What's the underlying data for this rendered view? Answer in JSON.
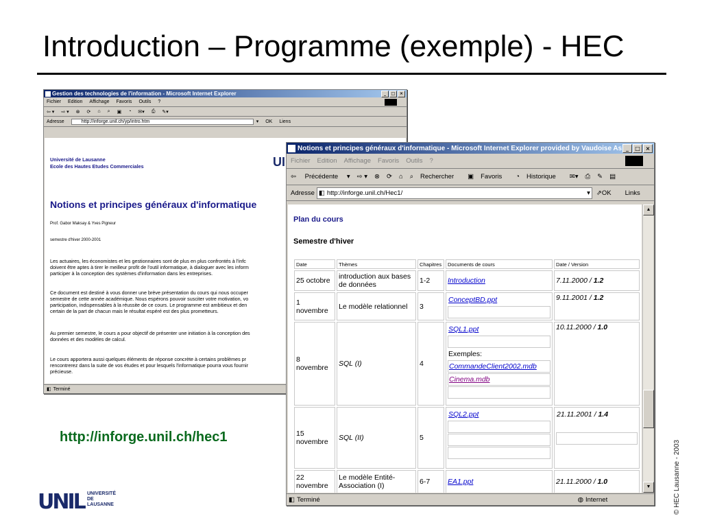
{
  "slide": {
    "title": "Introduction – Programme (exemple) - HEC",
    "url": "http://inforge.unil.ch/hec1",
    "copyright": "© HEC Lausanne - 2003",
    "logo_mark": "UNIL",
    "logo_words": [
      "UNIVERSITÉ",
      "DE",
      "LAUSANNE"
    ]
  },
  "back_window": {
    "title": "Gestion des technologies de l'information - Microsoft Internet Explorer",
    "menu": [
      "Fichier",
      "Edition",
      "Affichage",
      "Favoris",
      "Outils",
      "?"
    ],
    "address_label": "Adresse",
    "address": "http://inforge.unil.ch/yp/intro.htm",
    "go": "OK",
    "links": "Liens",
    "university": "Université de Lausanne",
    "school": "Ecole des Hautes Etudes Commerciales",
    "heading": "Notions et principes généraux d'informatique",
    "authors": "Prof. Gabor Maksay & Yves Pigneur",
    "semester": "semestre d'hiver 2000-2001",
    "paragraphs": [
      [
        "Les actuaires, les économistes et les gestionnaires sont de plus en plus confrontés à l'infc",
        "doivent être aptes à tirer le meilleur profit de l'outil informatique, à dialoguer avec les inform",
        "participer à la conception des systèmes d'information dans les entreprises."
      ],
      [
        "Ce document est destiné à vous donner une brève présentation du cours qui nous occuper",
        "semestre de cette année académique. Nous espérons pouvoir susciter votre motivation, vo",
        "participation, indispensables à la réussite de ce cours. Le programme est ambitieux et den",
        "certain de la part de chacun mais le résultat espéré est des plus prometteurs."
      ],
      [
        "Au premier semestre, le cours a pour objectif de présenter une initiation à la conception des",
        "données et des modèles de calcul."
      ],
      [
        "Le cours apportera aussi quelques éléments de réponse concrète à certains problèmes pr",
        "rencontrerez dans la suite de vos études et pour lesquels l'informatique pourra vous fournir",
        "précieuse."
      ]
    ],
    "status": "Terminé"
  },
  "front_window": {
    "title": "Notions et principes généraux d'informatique - Microsoft Internet Explorer provided by Vaudoise As...",
    "menu": [
      "Fichier",
      "Edition",
      "Affichage",
      "Favoris",
      "Outils",
      "?"
    ],
    "toolbar": {
      "back": "Précédente",
      "search": "Rechercher",
      "favorites": "Favoris",
      "history": "Historique"
    },
    "address_label": "Adresse",
    "address": "http://inforge.unil.ch/Hec1/",
    "go": "OK",
    "links": "Links",
    "plan_title": "Plan du cours",
    "semester": "Semestre d'hiver",
    "columns": [
      "Date",
      "Thèmes",
      "Chapitres",
      "Documents de cours",
      "Date / Version"
    ],
    "rows": [
      {
        "date": "25 octobre",
        "theme": "introduction aux bases de données",
        "chap": "1-2",
        "docs": [
          "Introduction"
        ],
        "version": "7.11.2000 / ",
        "ver": "1.2"
      },
      {
        "date": "1 novembre",
        "theme": "Le modèle relationnel",
        "chap": "3",
        "docs": [
          "ConceptBD.ppt"
        ],
        "version": "9.11.2001 / ",
        "ver": "1.2"
      },
      {
        "date": "8 novembre",
        "theme": "SQL (I)",
        "chap": "4",
        "docs": [
          "SQL1.ppt",
          "Exemples:",
          "CommandeClient2002.mdb",
          "Cinema.mdb"
        ],
        "version": "10.11.2000 / ",
        "ver": "1.0"
      },
      {
        "date": "15 novembre",
        "theme": "SQL (II)",
        "chap": "5",
        "docs": [
          "SQL2.ppt"
        ],
        "version": "21.11.2001 / ",
        "ver": "1.4"
      },
      {
        "date": "22 novembre",
        "theme": "Le modèle Entité-Association (I)",
        "chap": "6-7",
        "docs": [
          "EA1.ppt"
        ],
        "version": "21.11.2000 / ",
        "ver": "1.0"
      }
    ],
    "status": "Terminé",
    "zone": "Internet"
  }
}
